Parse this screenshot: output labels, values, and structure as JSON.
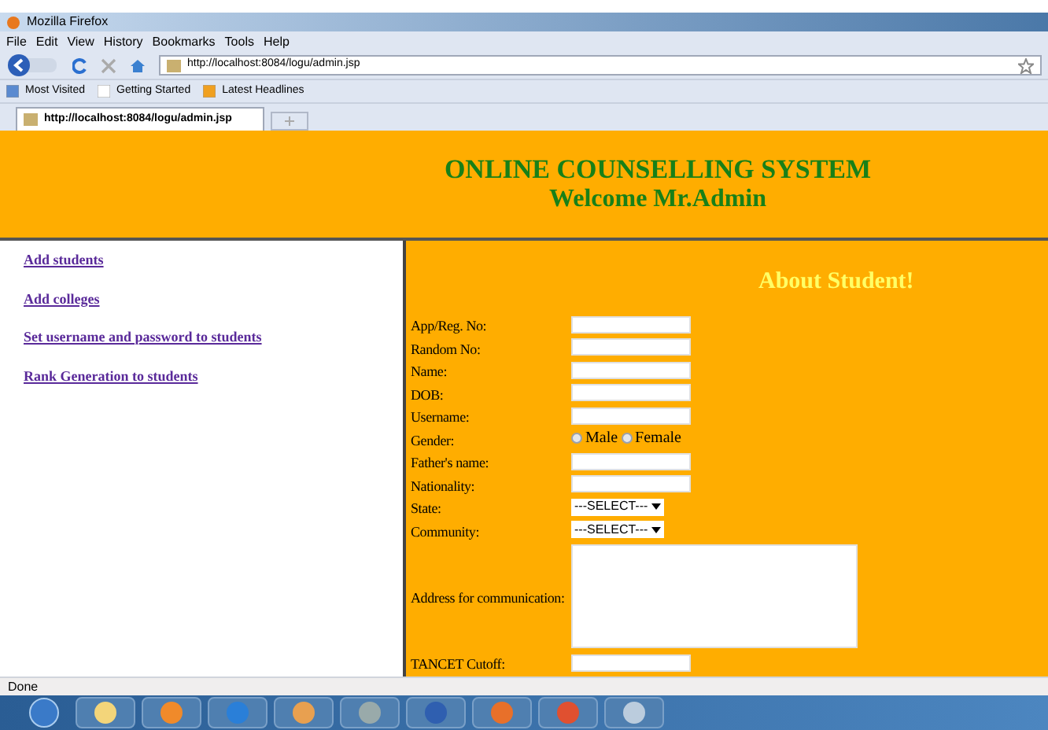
{
  "window": {
    "title": "Mozilla Firefox"
  },
  "menu": [
    "File",
    "Edit",
    "View",
    "History",
    "Bookmarks",
    "Tools",
    "Help"
  ],
  "address": {
    "value": "http://localhost:8084/logu/admin.jsp"
  },
  "bookmarks": [
    "Most Visited",
    "Getting Started",
    "Latest Headlines"
  ],
  "tabs": [
    {
      "label": "http://localhost:8084/logu/admin.jsp",
      "selected": true
    }
  ],
  "header": {
    "title": "ONLINE COUNSELLING SYSTEM",
    "subtitle": "Welcome Mr.Admin"
  },
  "sidebar": {
    "links": [
      "Add students",
      "Add colleges",
      "Set username and password to students",
      "Rank Generation to students"
    ]
  },
  "form": {
    "title": "About Student!",
    "fields": [
      {
        "label": "App/Reg. No:",
        "kind": "text"
      },
      {
        "label": "Random No:",
        "kind": "text"
      },
      {
        "label": "Name:",
        "kind": "text"
      },
      {
        "label": "DOB:",
        "kind": "text"
      },
      {
        "label": "Username:",
        "kind": "text"
      },
      {
        "label": "Gender:",
        "kind": "radio",
        "options": [
          {
            "label": "Male",
            "selected": false
          },
          {
            "label": "Female",
            "selected": false
          }
        ]
      },
      {
        "label": "Father's name:",
        "kind": "text"
      },
      {
        "label": "Nationality:",
        "kind": "text"
      },
      {
        "label": "State:",
        "kind": "select",
        "value": "---SELECT---"
      },
      {
        "label": "Community:",
        "kind": "select",
        "value": "---SELECT---"
      },
      {
        "label": "Address for communication:",
        "kind": "textarea"
      },
      {
        "label": "TANCET Cutoff:",
        "kind": "text"
      }
    ]
  },
  "status_bar": {
    "text": "Done"
  }
}
